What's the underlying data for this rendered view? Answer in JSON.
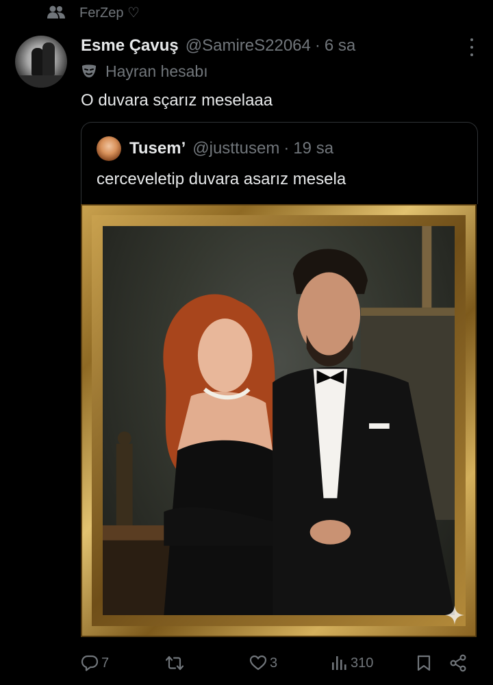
{
  "social_context": {
    "text": "FerZep ♡",
    "icon": "people-icon"
  },
  "tweet": {
    "author_name": "Esme Çavuş",
    "handle": "@SamireS22064",
    "dot": "·",
    "time": "6 sa",
    "label": "Hayran hesabı",
    "label_icon": "theater-mask-icon",
    "text": "O duvara sçarız meselaaa"
  },
  "quote": {
    "author_name": "Tusemʼ",
    "handle": "@justtusem",
    "dot": "·",
    "time": "19 sa",
    "text": "cerceveletip duvara asarız mesela"
  },
  "actions": {
    "replies": "7",
    "retweets": "",
    "likes": "3",
    "views": "310"
  },
  "colors": {
    "background": "#000000",
    "text": "#e7e9ea",
    "muted": "#71767b",
    "border": "#2f3336",
    "frame_gold": "#c9a14e"
  }
}
